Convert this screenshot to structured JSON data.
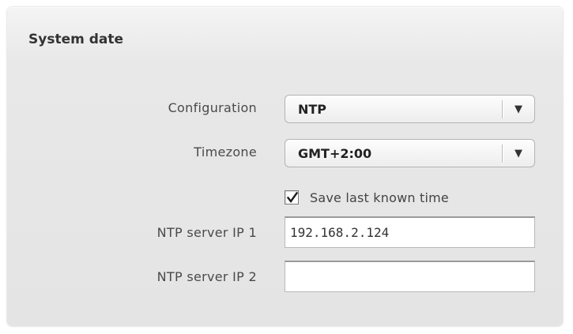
{
  "section": {
    "title": "System date"
  },
  "configuration": {
    "label": "Configuration",
    "value": "NTP",
    "arrow": "▼"
  },
  "timezone": {
    "label": "Timezone",
    "value": "GMT+2:00",
    "arrow": "▼"
  },
  "save_last_known_time": {
    "label": "Save last known time",
    "checked": true
  },
  "ntp_server_1": {
    "label": "NTP server IP 1",
    "value": "192.168.2.124"
  },
  "ntp_server_2": {
    "label": "NTP server IP 2",
    "value": ""
  }
}
